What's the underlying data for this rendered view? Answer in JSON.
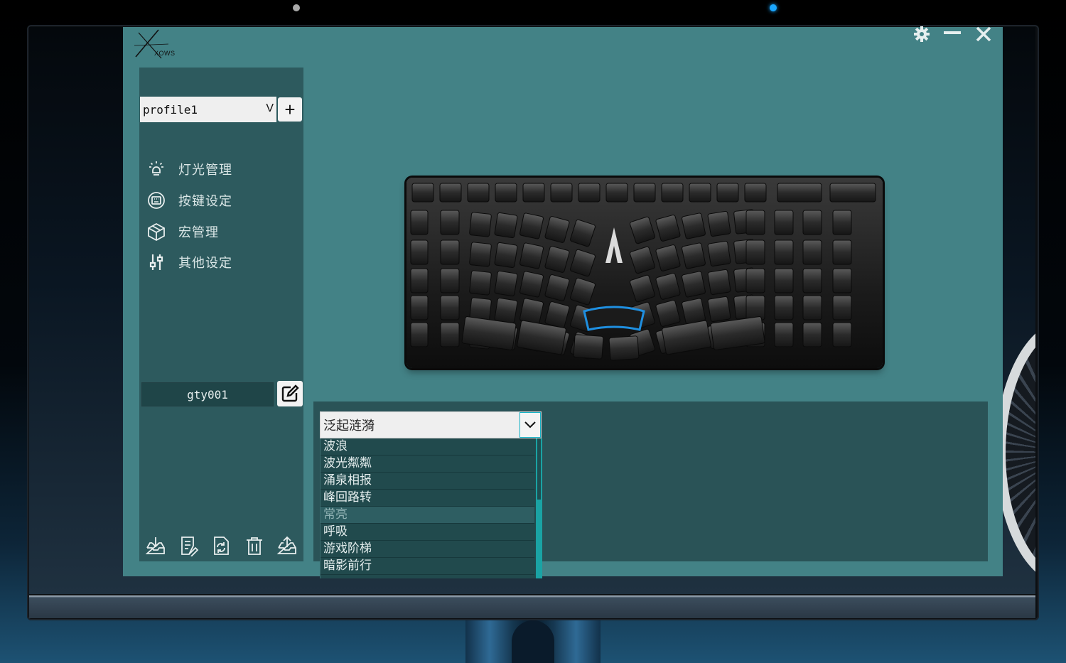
{
  "app": {
    "logo_text": "XOWS",
    "window_controls": [
      "gear-icon",
      "minimize-icon",
      "close-icon"
    ],
    "colors": {
      "app_bg": "#438286",
      "sidebar_bg": "#2d5a5e",
      "panel_bg": "#2a5357",
      "accent": "#16b2c6"
    }
  },
  "sidebar": {
    "profile": {
      "selected": "profile1",
      "caret": "V",
      "add_label": "+"
    },
    "menu": [
      {
        "icon": "lightbulb-icon",
        "label": "灯光管理"
      },
      {
        "icon": "keypad-icon",
        "label": "按键设定"
      },
      {
        "icon": "cube-icon",
        "label": "宏管理"
      },
      {
        "icon": "sliders-icon",
        "label": "其他设定"
      }
    ],
    "user_name": "gty001",
    "toolbar": [
      "import-icon",
      "notes-icon",
      "refresh-file-icon",
      "trash-icon",
      "export-icon"
    ]
  },
  "effects": {
    "selected": "泛起涟漪",
    "options": [
      "波浪",
      "波光粼粼",
      "涌泉相报",
      "峰回路转",
      "常亮",
      "呼吸",
      "游戏阶梯",
      "暗影前行"
    ],
    "highlighted": "常亮"
  }
}
